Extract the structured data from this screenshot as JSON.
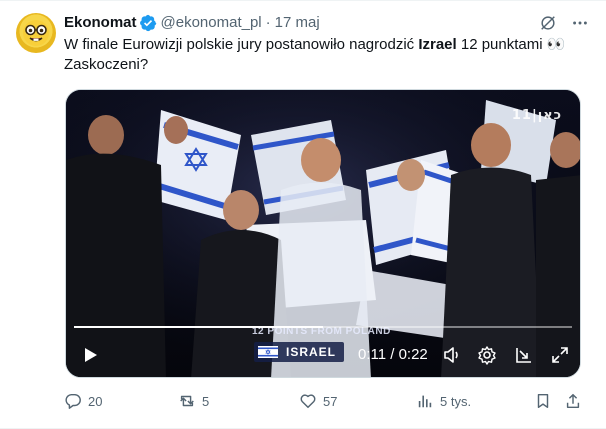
{
  "author": {
    "display_name": "Ekonomat",
    "handle": "@ekonomat_pl",
    "separator": "·",
    "date": "17 maj",
    "avatar_icon": "nerd-face-icon",
    "verified_icon": "verified-badge-icon",
    "verified_color": "#1d9bf0"
  },
  "tweet": {
    "text_part1": "W finale Eurowizji polskie jury postanowiło nagrodzić ",
    "text_bold": "Izrael",
    "text_part2": " 12 punktami ",
    "text_emoji": "👀",
    "text_line2": "Zaskoczeni?"
  },
  "video": {
    "channel_logo": "11|כאן",
    "lower_third_text": "12 POINTS FROM POLAND",
    "country_label": "ISRAEL",
    "time_current": "0:11",
    "time_separator": " / ",
    "time_total": "0:22",
    "time_display": "0:11 / 0:22",
    "progress": 0.5,
    "controls": [
      "play-icon",
      "volume-icon",
      "settings-gear-icon",
      "pop-out-icon",
      "fullscreen-icon"
    ]
  },
  "actions": {
    "replies": "20",
    "reposts": "5",
    "likes": "57",
    "views": "5 tys."
  },
  "colors": {
    "text": "#0f1419",
    "secondary": "#536471",
    "border": "#cfd9de",
    "accent": "#1d9bf0"
  }
}
